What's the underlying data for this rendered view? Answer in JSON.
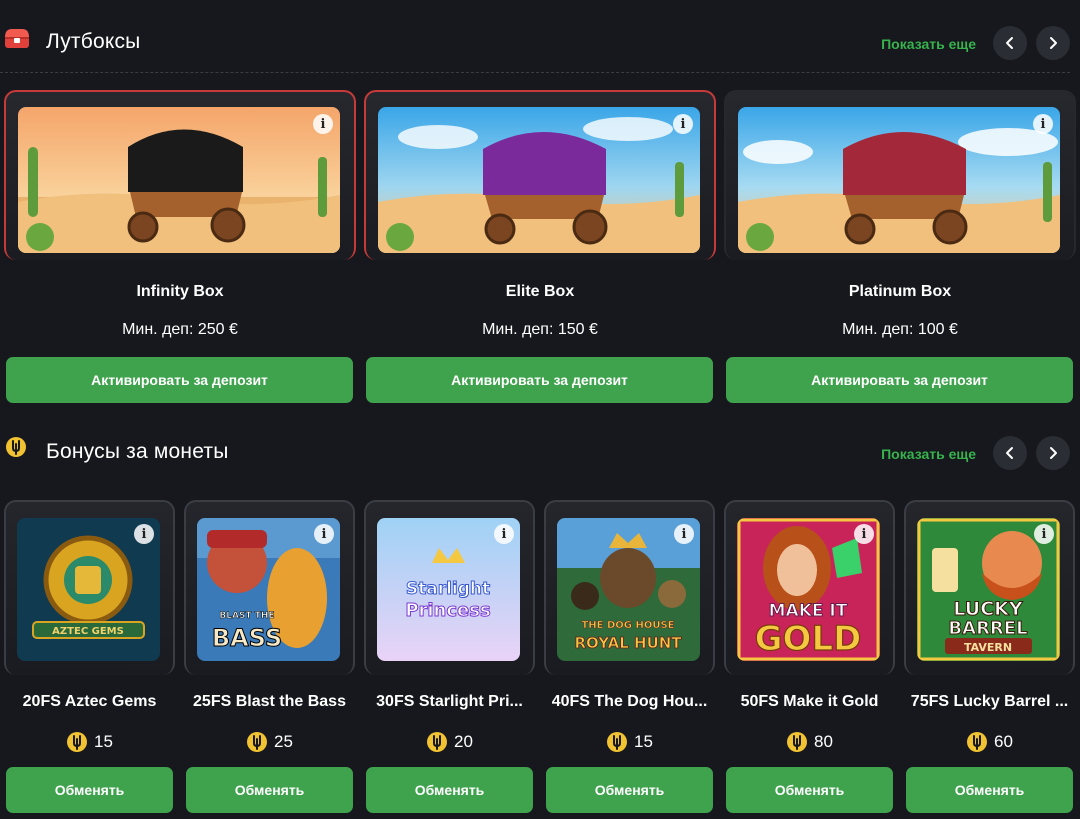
{
  "lootboxes": {
    "title": "Лутбоксы",
    "icon": "treasure-chest-icon",
    "show_more": "Показать еще",
    "items": [
      {
        "name": "Infinity Box",
        "min_deposit": "Мин. деп: 250 €",
        "button": "Активировать за депозит",
        "wagon_color": "#1a1a1a"
      },
      {
        "name": "Elite Box",
        "min_deposit": "Мин. деп: 150 €",
        "button": "Активировать за депозит",
        "wagon_color": "#7a2a9a"
      },
      {
        "name": "Platinum Box",
        "min_deposit": "Мин. деп: 100 €",
        "button": "Активировать за депозит",
        "wagon_color": "#a3283a"
      }
    ]
  },
  "coin_bonuses": {
    "title": "Бонусы за монеты",
    "icon": "coin-icon",
    "show_more": "Показать еще",
    "items": [
      {
        "name": "20FS Aztec Gems",
        "price": "15",
        "button": "Обменять",
        "art_text": "AZTEC GEMS"
      },
      {
        "name": "25FS Blast the Bass",
        "price": "25",
        "button": "Обменять",
        "art_text": "BLAST THE BASS"
      },
      {
        "name": "30FS Starlight Pri...",
        "price": "20",
        "button": "Обменять",
        "art_text": "Starlight Princess"
      },
      {
        "name": "40FS The Dog Hou...",
        "price": "15",
        "button": "Обменять",
        "art_text": "THE DOG HOUSE ROYAL HUNT"
      },
      {
        "name": "50FS Make it Gold",
        "price": "80",
        "button": "Обменять",
        "art_text": "MAKE IT GOLD"
      },
      {
        "name": "75FS Lucky Barrel ...",
        "price": "60",
        "button": "Обменять",
        "art_text": "LUCKY BARREL TAVERN"
      }
    ]
  },
  "colors": {
    "accent_green": "#3fa34d",
    "link_green": "#37b24d",
    "background": "#16181d",
    "lootbox_border": "#c83a3a"
  }
}
